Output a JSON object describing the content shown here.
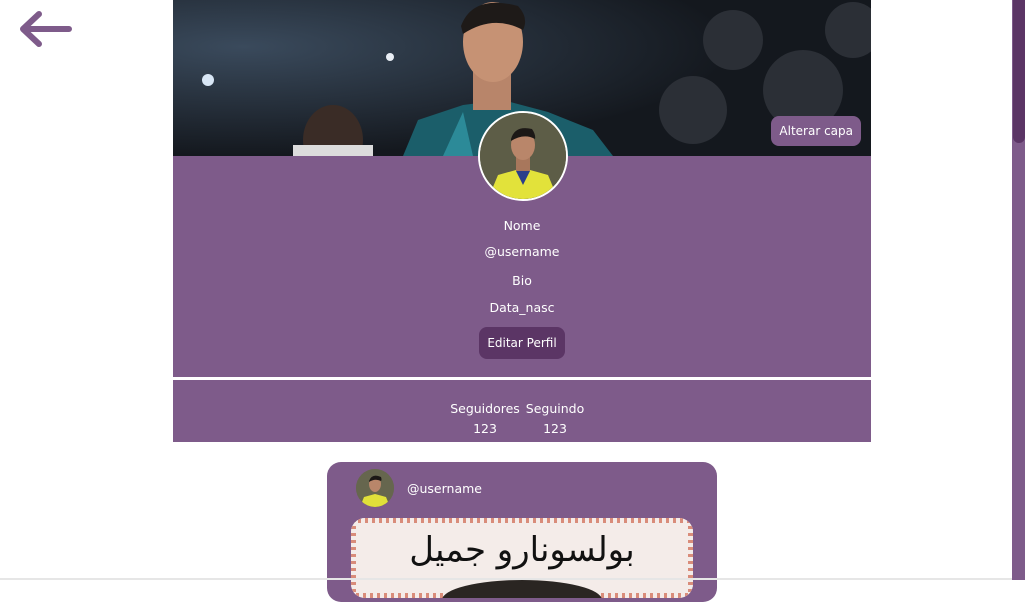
{
  "colors": {
    "accent": "#7e5b8a",
    "accent_dark": "#5b3565",
    "text": "#ffffff"
  },
  "nav": {
    "back_icon": "arrow-left-icon"
  },
  "cover": {
    "change_label": "Alterar capa"
  },
  "profile": {
    "name": "Nome",
    "username": "@username",
    "bio": "Bio",
    "birthdate": "Data_nasc",
    "edit_label": "Editar Perfil"
  },
  "stats": {
    "followers_label": "Seguidores",
    "followers_count": "123",
    "following_label": "Seguindo",
    "following_count": "123"
  },
  "post": {
    "username": "@username",
    "image_text": "بولسونارو جميل"
  }
}
